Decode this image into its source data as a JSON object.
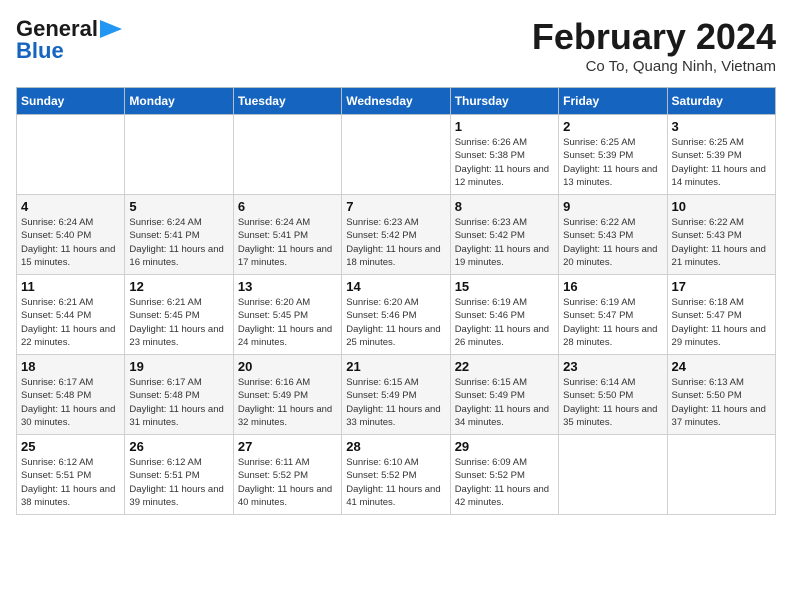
{
  "header": {
    "logo_line1": "General",
    "logo_line2": "Blue",
    "month_title": "February 2024",
    "location": "Co To, Quang Ninh, Vietnam"
  },
  "weekdays": [
    "Sunday",
    "Monday",
    "Tuesday",
    "Wednesday",
    "Thursday",
    "Friday",
    "Saturday"
  ],
  "weeks": [
    [
      {
        "day": "",
        "detail": ""
      },
      {
        "day": "",
        "detail": ""
      },
      {
        "day": "",
        "detail": ""
      },
      {
        "day": "",
        "detail": ""
      },
      {
        "day": "1",
        "detail": "Sunrise: 6:26 AM\nSunset: 5:38 PM\nDaylight: 11 hours and 12 minutes."
      },
      {
        "day": "2",
        "detail": "Sunrise: 6:25 AM\nSunset: 5:39 PM\nDaylight: 11 hours and 13 minutes."
      },
      {
        "day": "3",
        "detail": "Sunrise: 6:25 AM\nSunset: 5:39 PM\nDaylight: 11 hours and 14 minutes."
      }
    ],
    [
      {
        "day": "4",
        "detail": "Sunrise: 6:24 AM\nSunset: 5:40 PM\nDaylight: 11 hours and 15 minutes."
      },
      {
        "day": "5",
        "detail": "Sunrise: 6:24 AM\nSunset: 5:41 PM\nDaylight: 11 hours and 16 minutes."
      },
      {
        "day": "6",
        "detail": "Sunrise: 6:24 AM\nSunset: 5:41 PM\nDaylight: 11 hours and 17 minutes."
      },
      {
        "day": "7",
        "detail": "Sunrise: 6:23 AM\nSunset: 5:42 PM\nDaylight: 11 hours and 18 minutes."
      },
      {
        "day": "8",
        "detail": "Sunrise: 6:23 AM\nSunset: 5:42 PM\nDaylight: 11 hours and 19 minutes."
      },
      {
        "day": "9",
        "detail": "Sunrise: 6:22 AM\nSunset: 5:43 PM\nDaylight: 11 hours and 20 minutes."
      },
      {
        "day": "10",
        "detail": "Sunrise: 6:22 AM\nSunset: 5:43 PM\nDaylight: 11 hours and 21 minutes."
      }
    ],
    [
      {
        "day": "11",
        "detail": "Sunrise: 6:21 AM\nSunset: 5:44 PM\nDaylight: 11 hours and 22 minutes."
      },
      {
        "day": "12",
        "detail": "Sunrise: 6:21 AM\nSunset: 5:45 PM\nDaylight: 11 hours and 23 minutes."
      },
      {
        "day": "13",
        "detail": "Sunrise: 6:20 AM\nSunset: 5:45 PM\nDaylight: 11 hours and 24 minutes."
      },
      {
        "day": "14",
        "detail": "Sunrise: 6:20 AM\nSunset: 5:46 PM\nDaylight: 11 hours and 25 minutes."
      },
      {
        "day": "15",
        "detail": "Sunrise: 6:19 AM\nSunset: 5:46 PM\nDaylight: 11 hours and 26 minutes."
      },
      {
        "day": "16",
        "detail": "Sunrise: 6:19 AM\nSunset: 5:47 PM\nDaylight: 11 hours and 28 minutes."
      },
      {
        "day": "17",
        "detail": "Sunrise: 6:18 AM\nSunset: 5:47 PM\nDaylight: 11 hours and 29 minutes."
      }
    ],
    [
      {
        "day": "18",
        "detail": "Sunrise: 6:17 AM\nSunset: 5:48 PM\nDaylight: 11 hours and 30 minutes."
      },
      {
        "day": "19",
        "detail": "Sunrise: 6:17 AM\nSunset: 5:48 PM\nDaylight: 11 hours and 31 minutes."
      },
      {
        "day": "20",
        "detail": "Sunrise: 6:16 AM\nSunset: 5:49 PM\nDaylight: 11 hours and 32 minutes."
      },
      {
        "day": "21",
        "detail": "Sunrise: 6:15 AM\nSunset: 5:49 PM\nDaylight: 11 hours and 33 minutes."
      },
      {
        "day": "22",
        "detail": "Sunrise: 6:15 AM\nSunset: 5:49 PM\nDaylight: 11 hours and 34 minutes."
      },
      {
        "day": "23",
        "detail": "Sunrise: 6:14 AM\nSunset: 5:50 PM\nDaylight: 11 hours and 35 minutes."
      },
      {
        "day": "24",
        "detail": "Sunrise: 6:13 AM\nSunset: 5:50 PM\nDaylight: 11 hours and 37 minutes."
      }
    ],
    [
      {
        "day": "25",
        "detail": "Sunrise: 6:12 AM\nSunset: 5:51 PM\nDaylight: 11 hours and 38 minutes."
      },
      {
        "day": "26",
        "detail": "Sunrise: 6:12 AM\nSunset: 5:51 PM\nDaylight: 11 hours and 39 minutes."
      },
      {
        "day": "27",
        "detail": "Sunrise: 6:11 AM\nSunset: 5:52 PM\nDaylight: 11 hours and 40 minutes."
      },
      {
        "day": "28",
        "detail": "Sunrise: 6:10 AM\nSunset: 5:52 PM\nDaylight: 11 hours and 41 minutes."
      },
      {
        "day": "29",
        "detail": "Sunrise: 6:09 AM\nSunset: 5:52 PM\nDaylight: 11 hours and 42 minutes."
      },
      {
        "day": "",
        "detail": ""
      },
      {
        "day": "",
        "detail": ""
      }
    ]
  ]
}
